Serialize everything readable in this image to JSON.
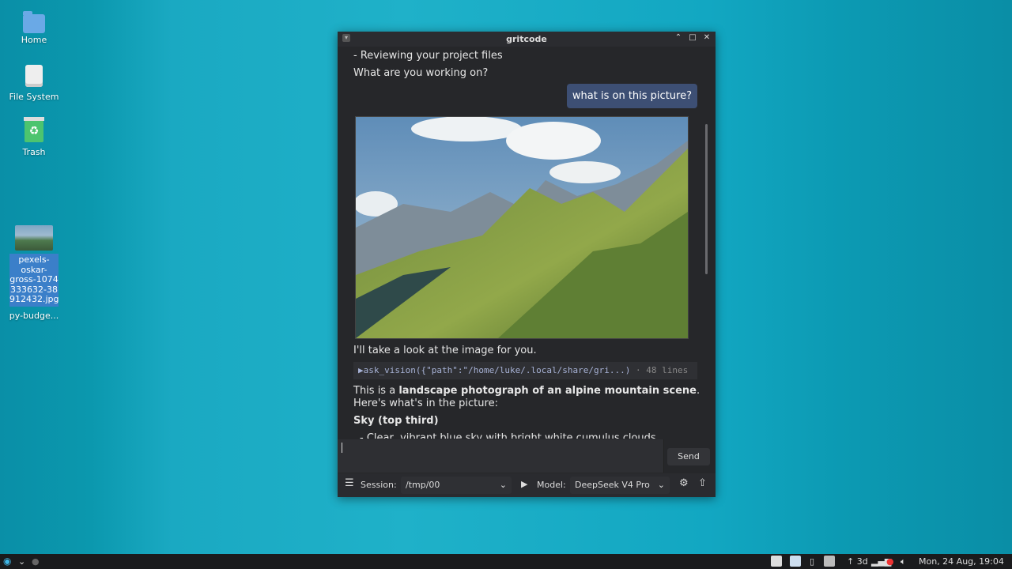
{
  "desktop": {
    "icons": [
      {
        "label": "Home"
      },
      {
        "label": "File System"
      },
      {
        "label": "Trash"
      }
    ],
    "file_icon": {
      "label": "pexels-oskar-gross-1074333632-38912432.jpg",
      "label_lines": [
        "pexels-",
        "oskar-",
        "gross-1074",
        "333632-38",
        "912432.jpg"
      ]
    },
    "folder_icon": {
      "label": "py-budge..."
    }
  },
  "window": {
    "title": "gritcode",
    "chat": {
      "line1": "- Reviewing your project files",
      "line2": "What are you working on?",
      "user_message": "what is on this picture?",
      "assistant_intro": "I'll take a look at the image for you.",
      "tool_call": "▶ask_vision({\"path\":\"/home/luke/.local/share/gri...)",
      "tool_meta": "· 48 lines",
      "answer_prefix": "This is a ",
      "answer_bold": "landscape photograph of an alpine mountain scene",
      "answer_suffix": ".",
      "answer_line2": "Here's what's in the picture:",
      "section_heading": "Sky (top third)",
      "bullet_partial": "- Clear, vibrant blue sky with bright white cumulus clouds"
    },
    "input": {
      "value": "",
      "send_label": "Send"
    },
    "bottombar": {
      "session_label": "Session:",
      "session_value": "/tmp/00",
      "model_label": "Model:",
      "model_value": "DeepSeek V4 Pro"
    }
  },
  "taskbar": {
    "network": "↑ 3d",
    "clock": "Mon, 24 Aug, 19:04"
  },
  "colors": {
    "desktop_teal": "#1aa9c2",
    "window_bg": "#26272a",
    "user_bubble": "#3d4f74",
    "taskbar": "#1a1b1d"
  }
}
